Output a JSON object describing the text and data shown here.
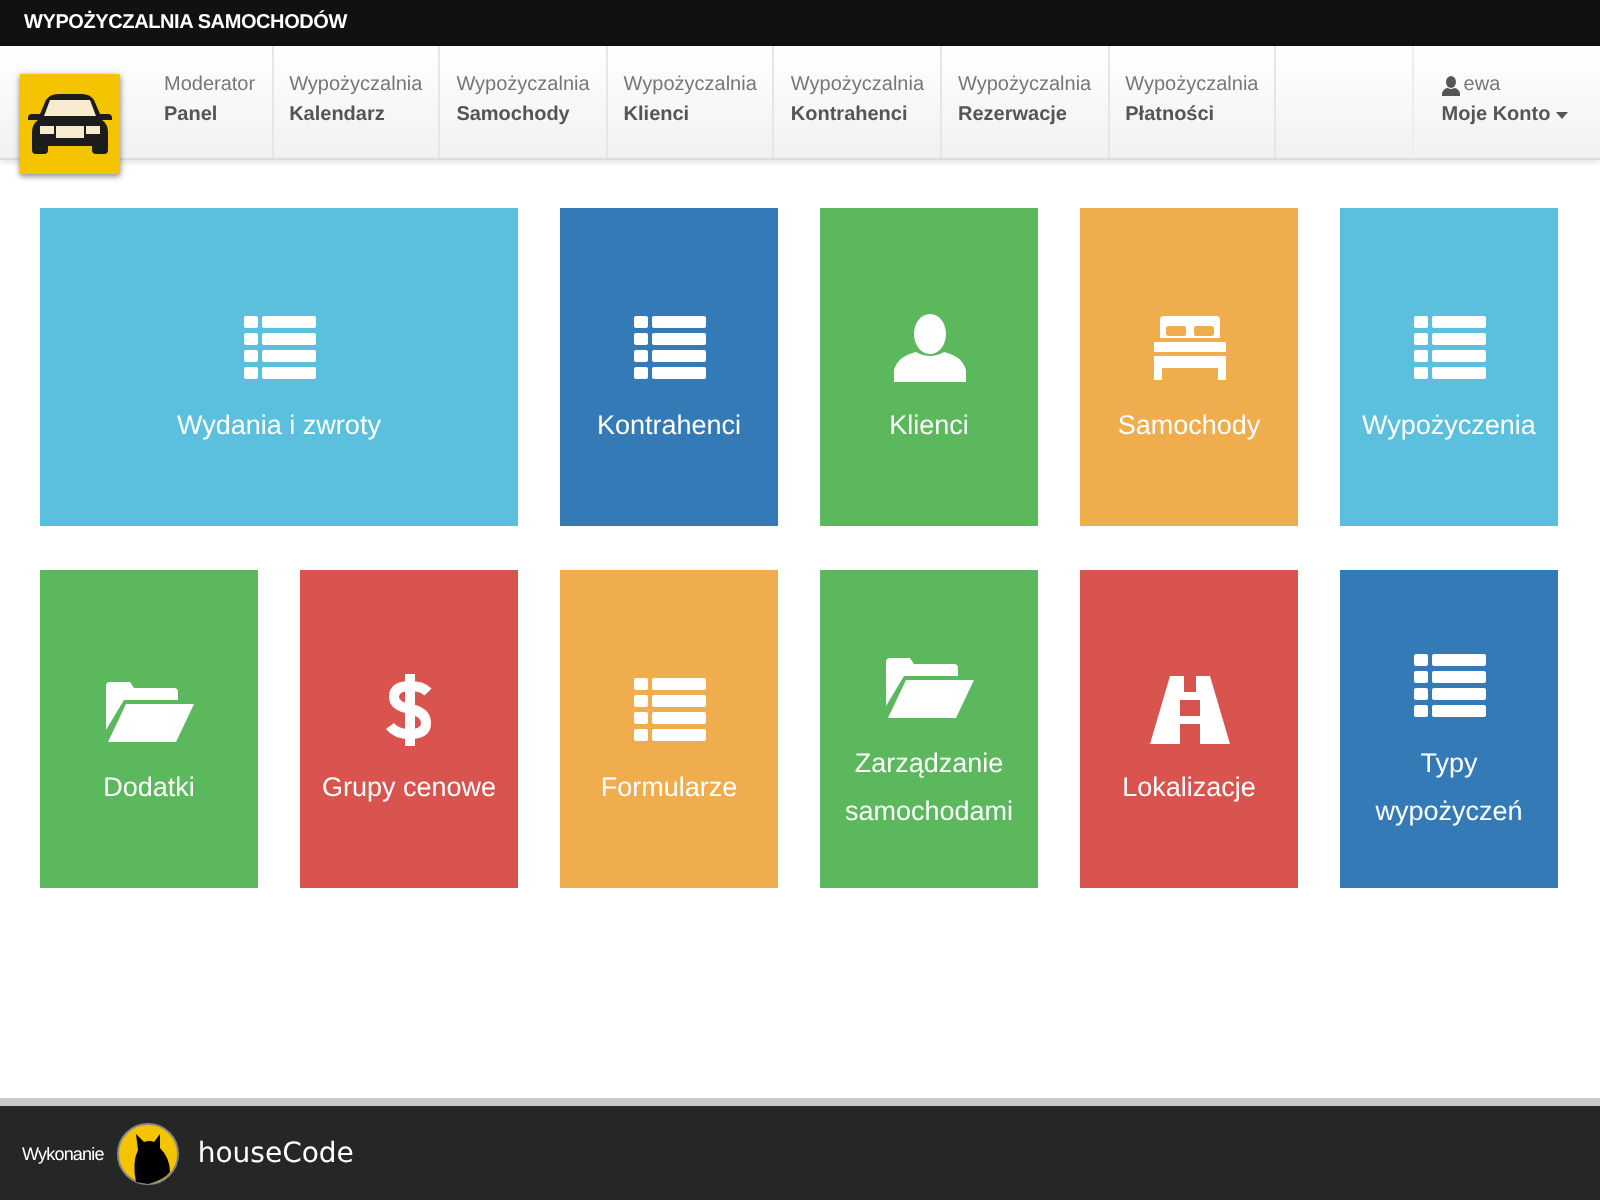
{
  "window": {
    "title": "WYPOŻYCZALNIA SAMOCHODÓW"
  },
  "nav": {
    "items": [
      {
        "top": "Moderator",
        "bottom": "Panel"
      },
      {
        "top": "Wypożyczalnia",
        "bottom": "Kalendarz"
      },
      {
        "top": "Wypożyczalnia",
        "bottom": "Samochody"
      },
      {
        "top": "Wypożyczalnia",
        "bottom": "Klienci"
      },
      {
        "top": "Wypożyczalnia",
        "bottom": "Kontrahenci"
      },
      {
        "top": "Wypożyczalnia",
        "bottom": "Rezerwacje"
      },
      {
        "top": "Wypożyczalnia",
        "bottom": "Płatności"
      }
    ],
    "account": {
      "user": "ewa",
      "label": "Moje Konto"
    }
  },
  "tiles": [
    {
      "label": "Wydania i zwroty",
      "kind": "list",
      "color": "#5bc0de",
      "wide": true
    },
    {
      "label": "Kontrahenci",
      "kind": "list",
      "color": "#337ab7",
      "wide": false
    },
    {
      "label": "Klienci",
      "kind": "user",
      "color": "#5cb85c",
      "wide": false
    },
    {
      "label": "Samochody",
      "kind": "bed",
      "color": "#f0ad4e",
      "wide": false
    },
    {
      "label": "Wypożyczenia",
      "kind": "list",
      "color": "#5bc0de",
      "wide": false
    },
    {
      "label": "Dodatki",
      "kind": "folder",
      "color": "#5cb85c",
      "wide": false
    },
    {
      "label": "Grupy cenowe",
      "kind": "dollar",
      "color": "#d9534f",
      "wide": false
    },
    {
      "label": "Formularze",
      "kind": "list",
      "color": "#f0ad4e",
      "wide": false
    },
    {
      "label": "Zarządzanie samochodami",
      "kind": "folder",
      "color": "#5cb85c",
      "wide": false
    },
    {
      "label": "Lokalizacje",
      "kind": "road",
      "color": "#d9534f",
      "wide": false
    },
    {
      "label": "Typy wypożyczeń",
      "kind": "list",
      "color": "#337ab7",
      "wide": false
    }
  ],
  "footer": {
    "credit": "Wykonanie",
    "brand": "houseCode"
  }
}
